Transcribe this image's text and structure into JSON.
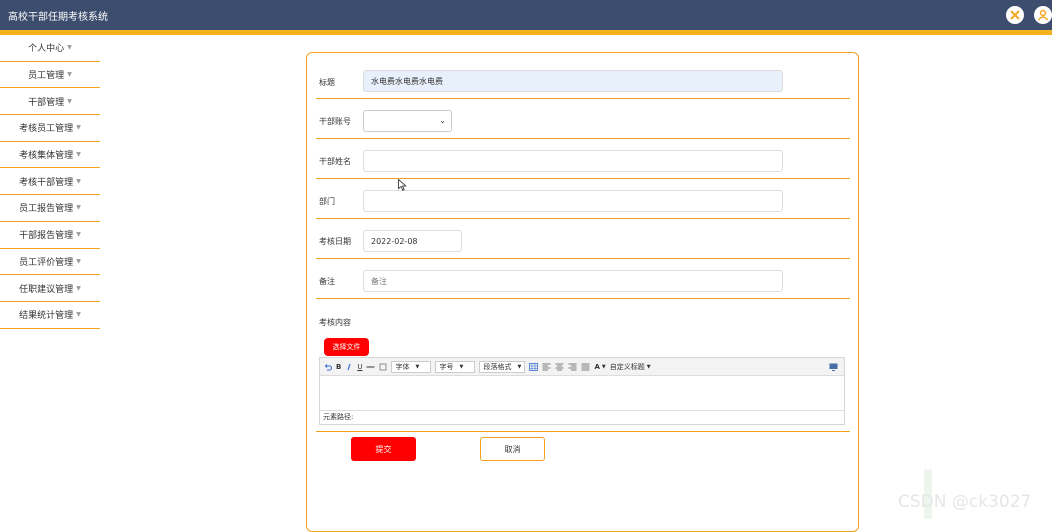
{
  "app": {
    "title": "高校干部任期考核系统"
  },
  "header": {
    "icons": [
      "settings-icon",
      "user-icon"
    ]
  },
  "sidebar": {
    "items": [
      {
        "label": "个人中心"
      },
      {
        "label": "员工管理"
      },
      {
        "label": "干部管理"
      },
      {
        "label": "考核员工管理"
      },
      {
        "label": "考核集体管理"
      },
      {
        "label": "考核干部管理"
      },
      {
        "label": "员工报告管理"
      },
      {
        "label": "干部报告管理"
      },
      {
        "label": "员工评价管理"
      },
      {
        "label": "任职建议管理"
      },
      {
        "label": "结果统计管理"
      }
    ],
    "caret": "▼"
  },
  "form": {
    "title_label": "标题",
    "title_value": "水电费水电费水电费",
    "cadre_no_label": "干部账号",
    "cadre_no_value": "",
    "cadre_name_label": "干部姓名",
    "cadre_name_value": "",
    "dept_label": "部门",
    "dept_value": "",
    "date_label": "考核日期",
    "date_value": "2022-02-08",
    "remark_label": "备注",
    "remark_placeholder": "备注",
    "content_label": "考核内容",
    "upload_label": "选择文件",
    "submit_label": "提交",
    "cancel_label": "取消"
  },
  "editor": {
    "toolbar": {
      "bold": "B",
      "underline": "U",
      "font_family": "字体",
      "font_size": "字号",
      "paragraph": "段落格式",
      "font_color": "A",
      "custom_title": "自定义标题"
    },
    "path_label": "元素路径:"
  },
  "watermark": "CSDN @ck3027",
  "colors": {
    "header": "#3c4d6e",
    "accent": "#f0a41e",
    "danger": "#ff0000"
  }
}
